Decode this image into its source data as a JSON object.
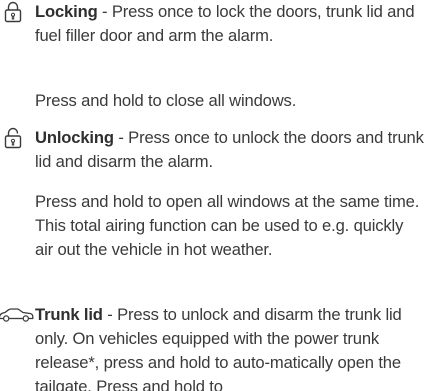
{
  "items": [
    {
      "icon": "padlock-locked-icon",
      "term": "Locking",
      "description": " - Press once to lock the doors, trunk lid and fuel filler door and arm the alarm.",
      "extra": "Press and hold to close all windows."
    },
    {
      "icon": "padlock-unlocked-icon",
      "term": "Unlocking",
      "description": " - Press once to unlock the doors and trunk lid and disarm the alarm.",
      "extra": "Press and hold to open all windows at the same time. This total airing function can be used to e.g. quickly air out the vehicle in hot weather."
    },
    {
      "icon": "car-trunk-icon",
      "term": "Trunk lid",
      "description": " - Press to unlock and disarm the trunk lid only. On vehicles equipped with the power trunk release*, press and hold to auto-matically open the tailgate. Press and hold to"
    }
  ],
  "colors": {
    "text": "#3a3a3a",
    "icon": "#3a3a3a"
  }
}
